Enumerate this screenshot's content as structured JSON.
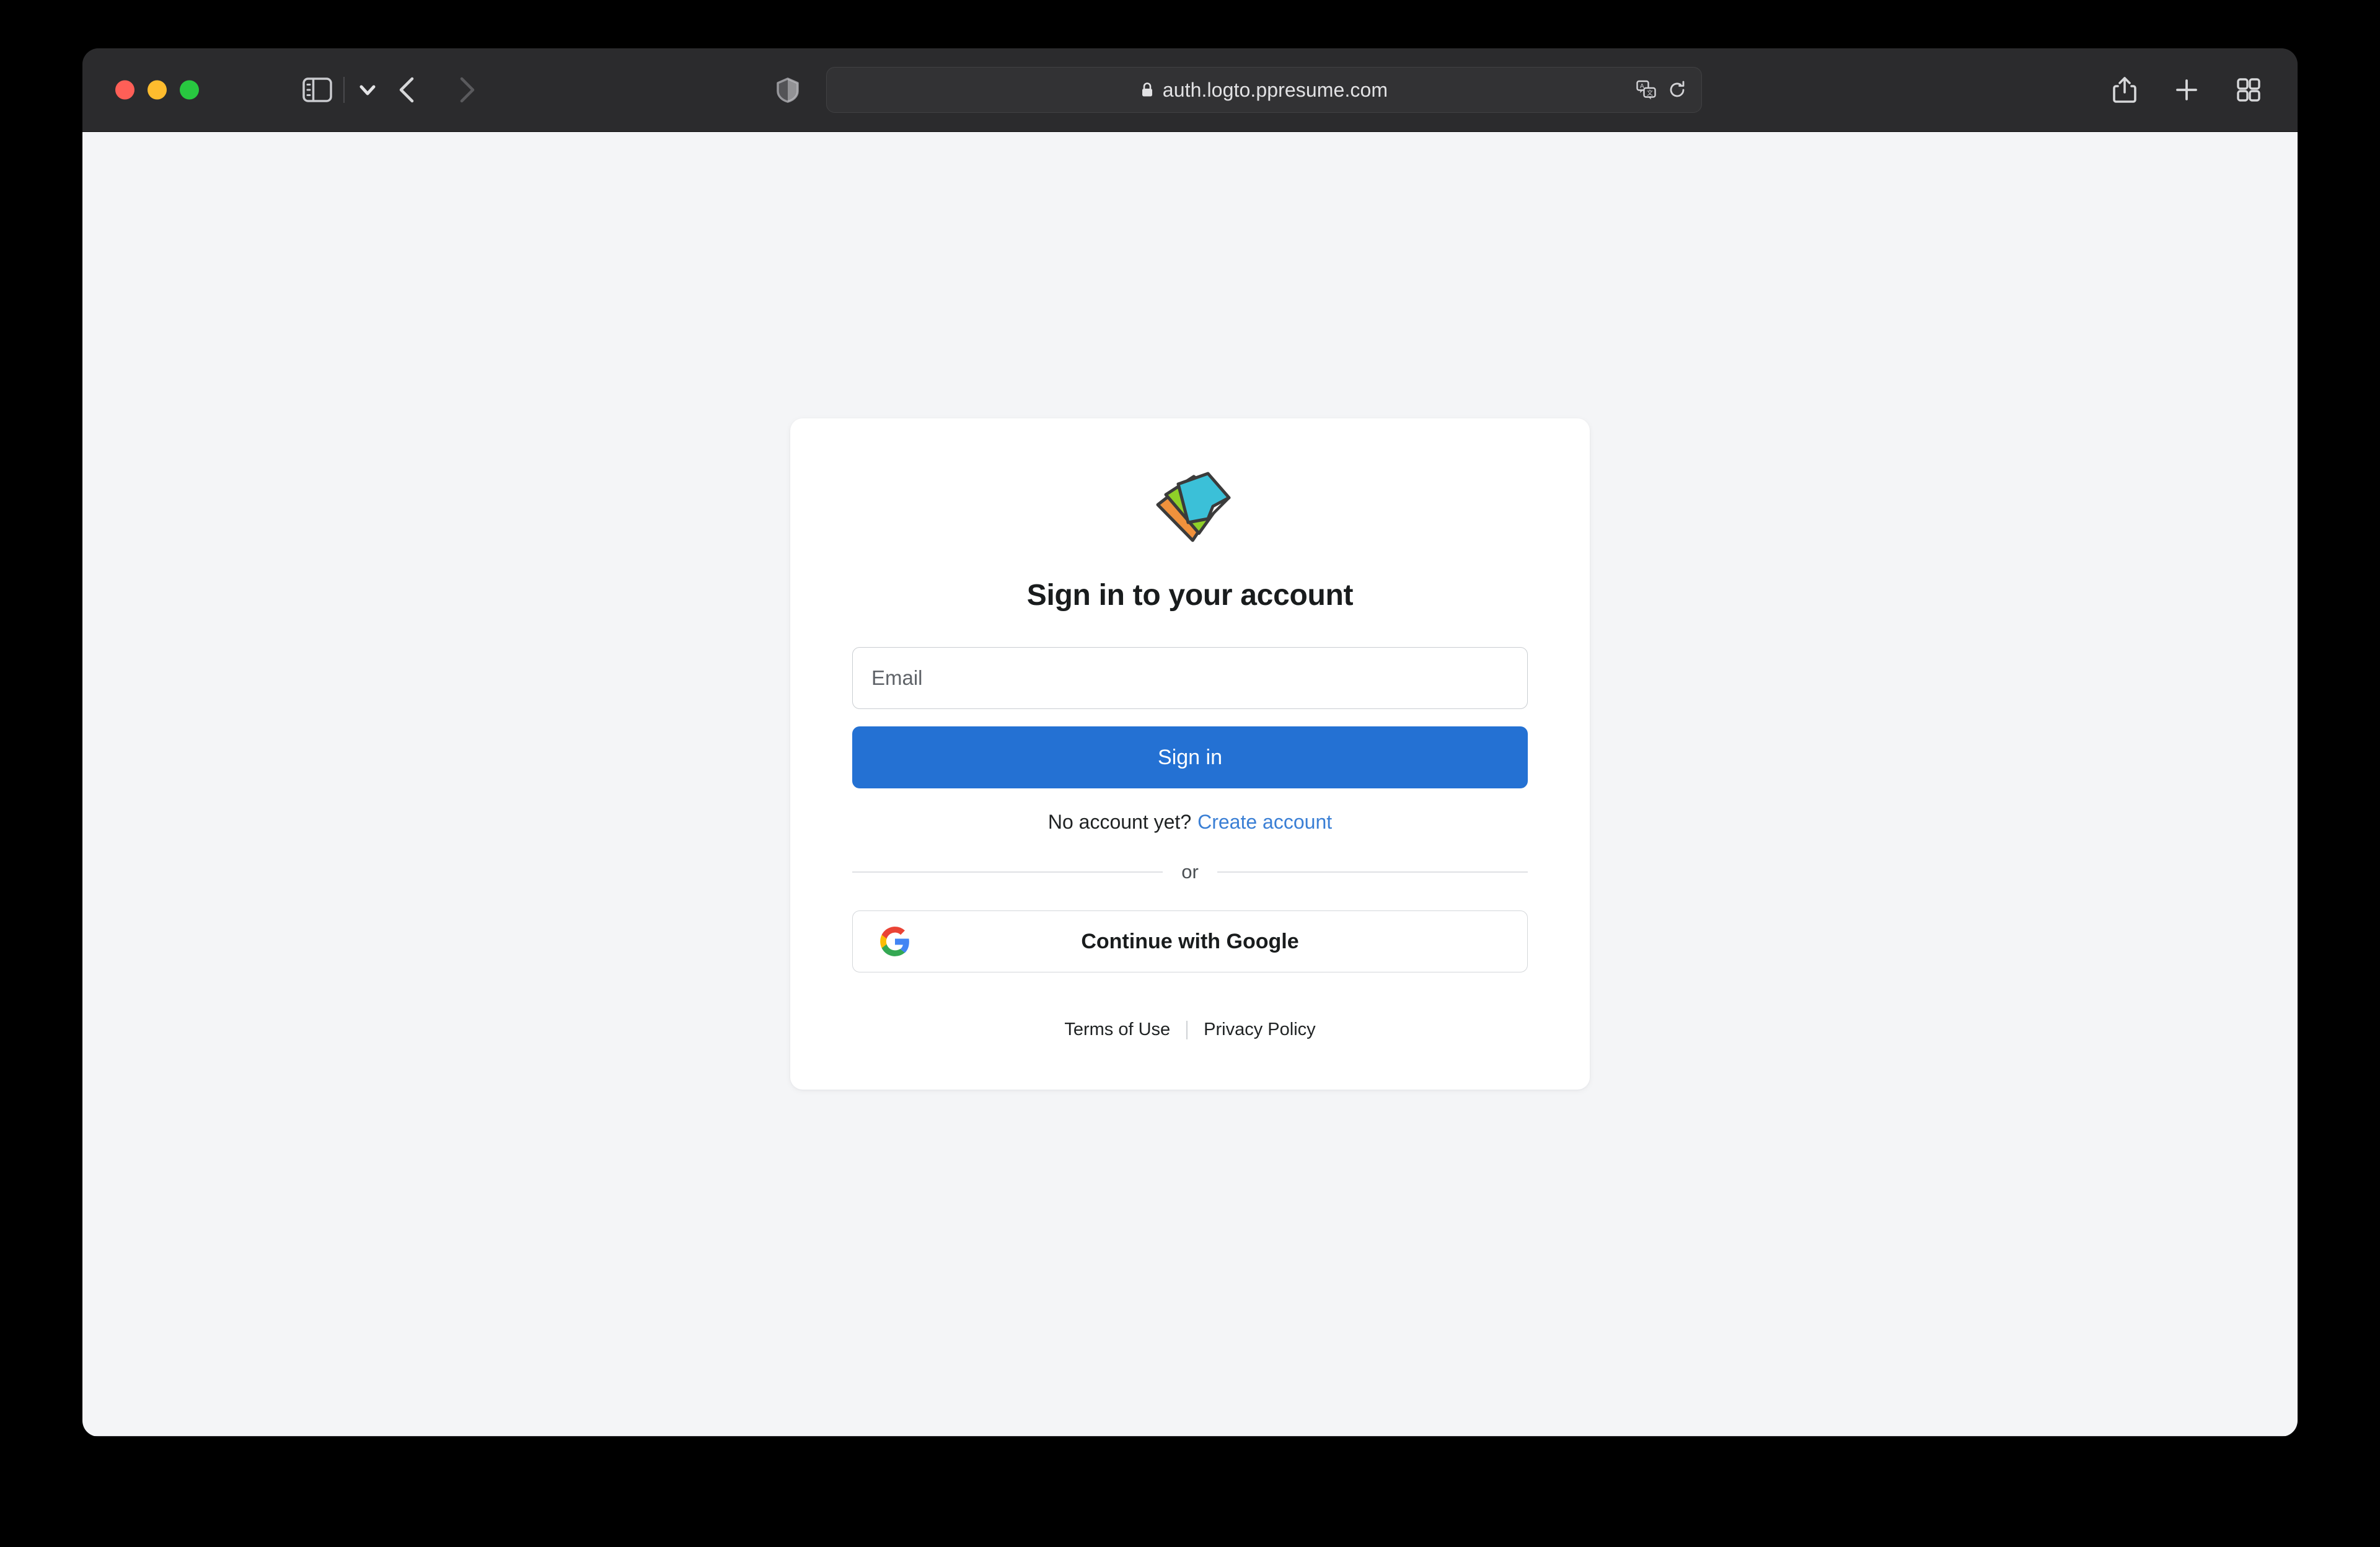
{
  "browser": {
    "window_controls": {
      "close_label": "Close",
      "minimize_label": "Minimize",
      "maximize_label": "Maximize"
    },
    "sidebar_toggle_label": "Show sidebar",
    "sidebar_dropdown_label": "Sidebar options",
    "back_label": "Back",
    "forward_label": "Forward",
    "privacy_report_label": "Privacy Report",
    "address": {
      "url": "auth.logto.ppresume.com",
      "secure": "Secure connection",
      "translate_label": "Translate",
      "reload_label": "Reload this page"
    },
    "share_label": "Share",
    "new_tab_label": "New Tab",
    "tab_overview_label": "Tab Overview"
  },
  "page": {
    "background_color": "#f4f5f7",
    "logo_name": "PPResume",
    "title": "Sign in to your account",
    "email": {
      "placeholder": "Email",
      "value": ""
    },
    "signin_label": "Sign in",
    "no_account_text": "No account yet?",
    "create_account_label": "Create account",
    "or_label": "or",
    "google_label": "Continue with Google",
    "terms_label": "Terms of Use",
    "privacy_label": "Privacy Policy",
    "colors": {
      "primary_button": "#2471d3",
      "link": "#3a7fd5",
      "logo_orange": "#f0913c",
      "logo_green": "#8fd028",
      "logo_cyan": "#3bc0d8"
    }
  }
}
